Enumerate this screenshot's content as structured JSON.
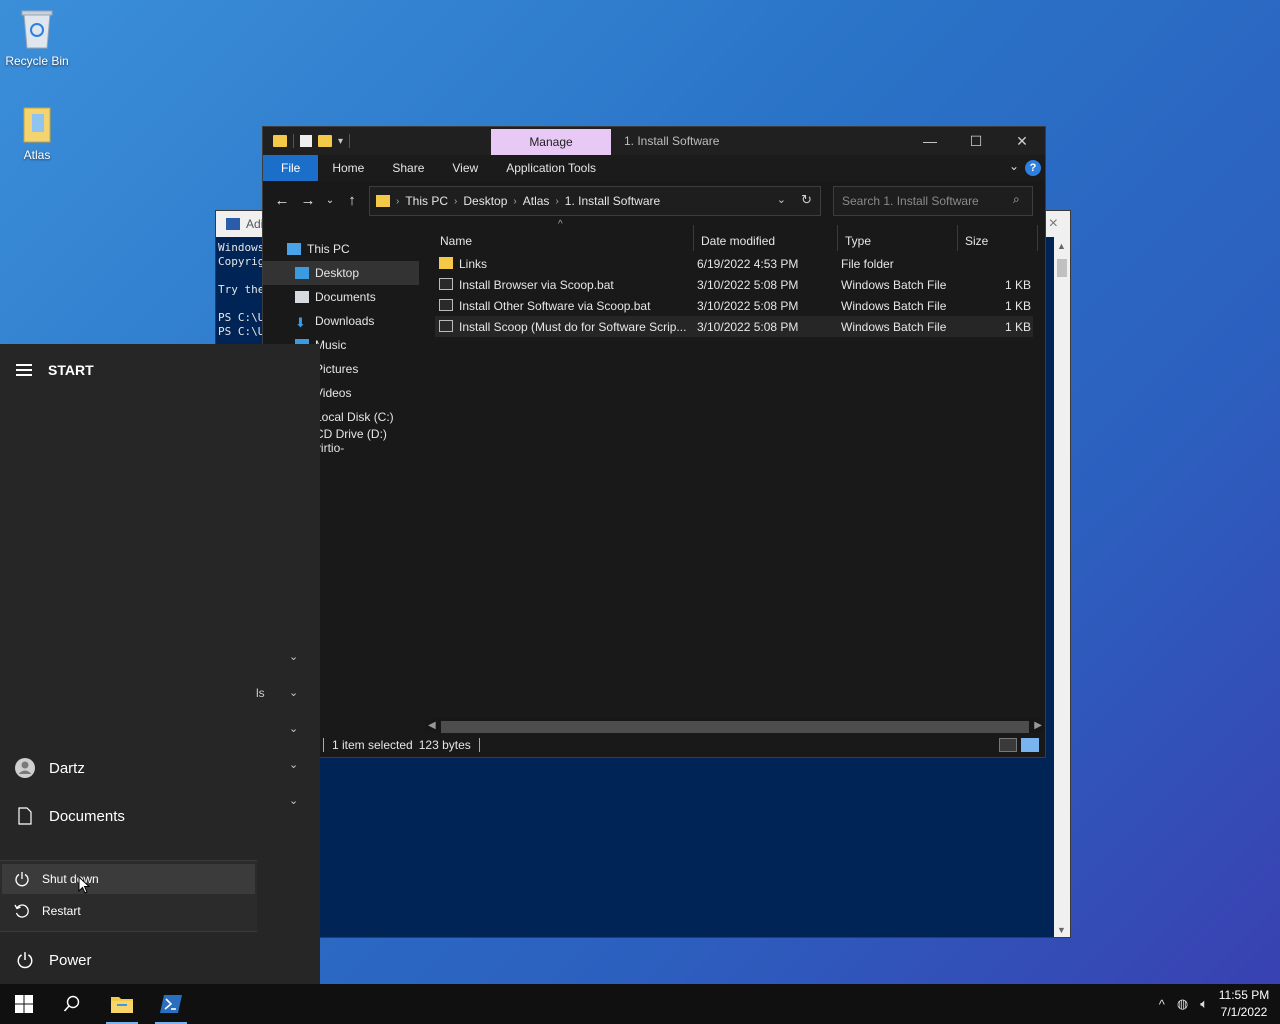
{
  "desktop": {
    "icons": [
      {
        "label": "Recycle Bin"
      },
      {
        "label": "Atlas"
      }
    ]
  },
  "powershell": {
    "title": "Adi",
    "lines": [
      "Windows",
      "Copyrig",
      "",
      "Try the",
      "",
      "PS C:\\U",
      "PS C:\\U"
    ]
  },
  "explorer": {
    "title": "1. Install Software",
    "manage_tab": "Manage",
    "ribbon_tabs": [
      "File",
      "Home",
      "Share",
      "View",
      "Application Tools"
    ],
    "breadcrumb": [
      "This PC",
      "Desktop",
      "Atlas",
      "1. Install Software"
    ],
    "search_placeholder": "Search 1. Install Software",
    "nav_items": [
      {
        "label": "This PC",
        "icon": "computer-icon"
      },
      {
        "label": "Desktop",
        "icon": "desktop-folder-icon"
      },
      {
        "label": "Documents",
        "icon": "documents-icon"
      },
      {
        "label": "Downloads",
        "icon": "downloads-icon"
      },
      {
        "label": "Music",
        "icon": "music-icon"
      },
      {
        "label": "Pictures",
        "icon": "pictures-icon"
      },
      {
        "label": "Videos",
        "icon": "videos-icon"
      },
      {
        "label": "Local Disk (C:)",
        "icon": "disk-icon"
      },
      {
        "label": "CD Drive (D:) virtio-",
        "icon": "cd-drive-icon"
      }
    ],
    "columns": [
      "Name",
      "Date modified",
      "Type",
      "Size"
    ],
    "files": [
      {
        "name": "Links",
        "date": "6/19/2022 4:53 PM",
        "type": "File folder",
        "size": "",
        "icon": "folder-icon"
      },
      {
        "name": "Install Browser via Scoop.bat",
        "date": "3/10/2022 5:08 PM",
        "type": "Windows Batch File",
        "size": "1 KB",
        "icon": "batch-file-icon"
      },
      {
        "name": "Install Other Software via Scoop.bat",
        "date": "3/10/2022 5:08 PM",
        "type": "Windows Batch File",
        "size": "1 KB",
        "icon": "batch-file-icon"
      },
      {
        "name": "Install Scoop (Must do for Software Scrip...",
        "date": "3/10/2022 5:08 PM",
        "type": "Windows Batch File",
        "size": "1 KB",
        "icon": "batch-file-icon"
      }
    ],
    "status": {
      "selected": "1 item selected",
      "size": "123 bytes"
    }
  },
  "start_menu": {
    "header": "START",
    "user": "Dartz",
    "documents": "Documents",
    "power_options": [
      "Shut down",
      "Restart"
    ],
    "power": "Power",
    "partial_label": "ls"
  },
  "taskbar": {
    "time": "11:55 PM",
    "date": "7/1/2022"
  },
  "colors": {
    "file_tab": "#1c6fc9",
    "manage_tab": "#e8c8f5",
    "folder": "#f3c947",
    "powershell_bg": "#012456"
  }
}
